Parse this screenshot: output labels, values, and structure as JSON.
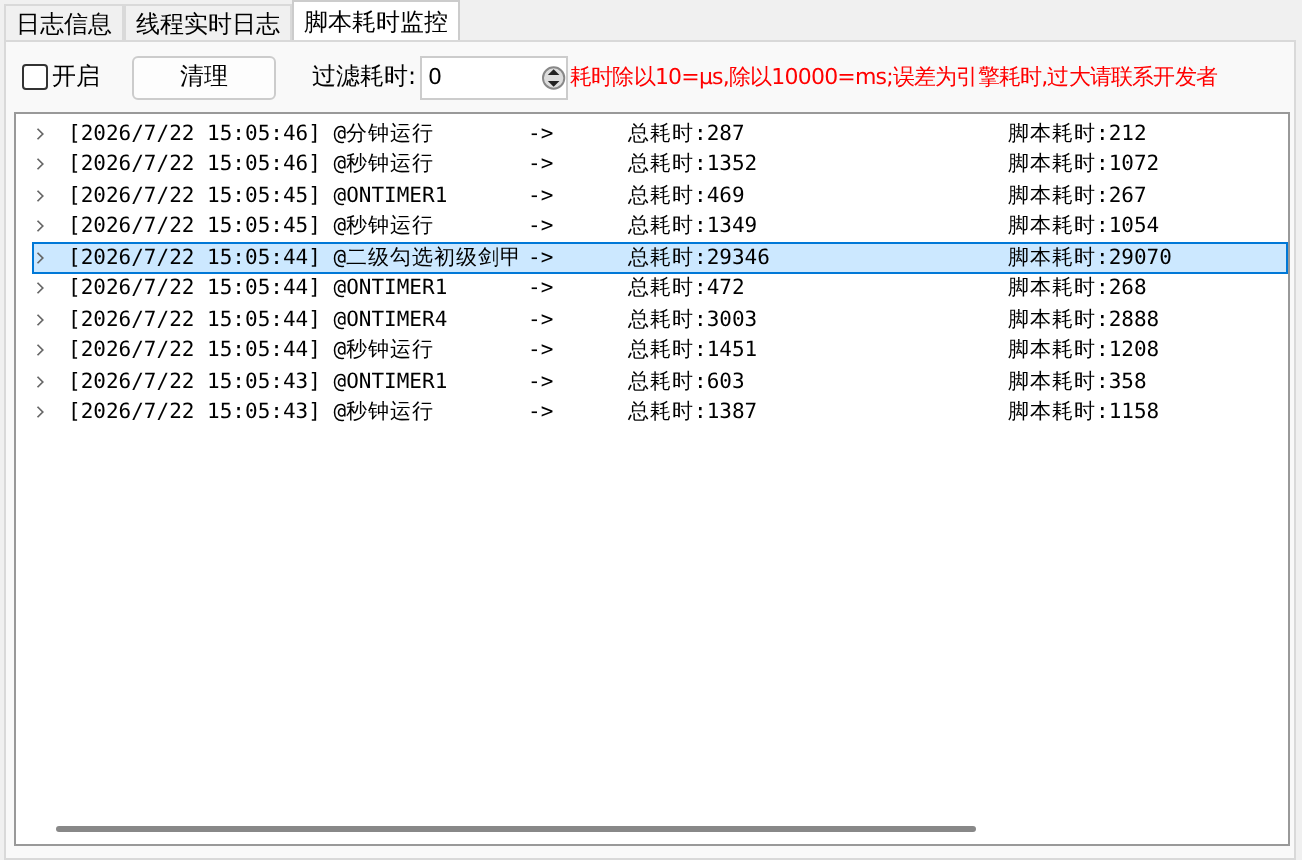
{
  "tabs": [
    {
      "label": "日志信息",
      "selected": false
    },
    {
      "label": "线程实时日志",
      "selected": false
    },
    {
      "label": "脚本耗时监控",
      "selected": true
    }
  ],
  "toolbar": {
    "enable": {
      "label": "开启",
      "checked": false
    },
    "clear_button": "清理",
    "filter": {
      "label": "过滤耗时:",
      "value": "0"
    },
    "note": "耗时除以10=μs,除以10000=ms;误差为引擎耗时,过大请联系开发者"
  },
  "rows": [
    {
      "label": "[2026/7/22 15:05:46] @分钟运行",
      "arrow": "->",
      "total": "总耗时:287",
      "script": "脚本耗时:212",
      "selected": false
    },
    {
      "label": "[2026/7/22 15:05:46] @秒钟运行",
      "arrow": "->",
      "total": "总耗时:1352",
      "script": "脚本耗时:1072",
      "selected": false
    },
    {
      "label": "[2026/7/22 15:05:45] @ONTIMER1",
      "arrow": "->",
      "total": "总耗时:469",
      "script": "脚本耗时:267",
      "selected": false
    },
    {
      "label": "[2026/7/22 15:05:45] @秒钟运行",
      "arrow": "->",
      "total": "总耗时:1349",
      "script": "脚本耗时:1054",
      "selected": false
    },
    {
      "label": "[2026/7/22 15:05:44] @二级勾选初级剑甲",
      "arrow": "->",
      "total": "总耗时:29346",
      "script": "脚本耗时:29070",
      "selected": true
    },
    {
      "label": "[2026/7/22 15:05:44] @ONTIMER1",
      "arrow": "->",
      "total": "总耗时:472",
      "script": "脚本耗时:268",
      "selected": false
    },
    {
      "label": "[2026/7/22 15:05:44] @ONTIMER4",
      "arrow": "->",
      "total": "总耗时:3003",
      "script": "脚本耗时:2888",
      "selected": false
    },
    {
      "label": "[2026/7/22 15:05:44] @秒钟运行",
      "arrow": "->",
      "total": "总耗时:1451",
      "script": "脚本耗时:1208",
      "selected": false
    },
    {
      "label": "[2026/7/22 15:05:43] @ONTIMER1",
      "arrow": "->",
      "total": "总耗时:603",
      "script": "脚本耗时:358",
      "selected": false
    },
    {
      "label": "[2026/7/22 15:05:43] @秒钟运行",
      "arrow": "->",
      "total": "总耗时:1387",
      "script": "脚本耗时:1158",
      "selected": false
    }
  ]
}
